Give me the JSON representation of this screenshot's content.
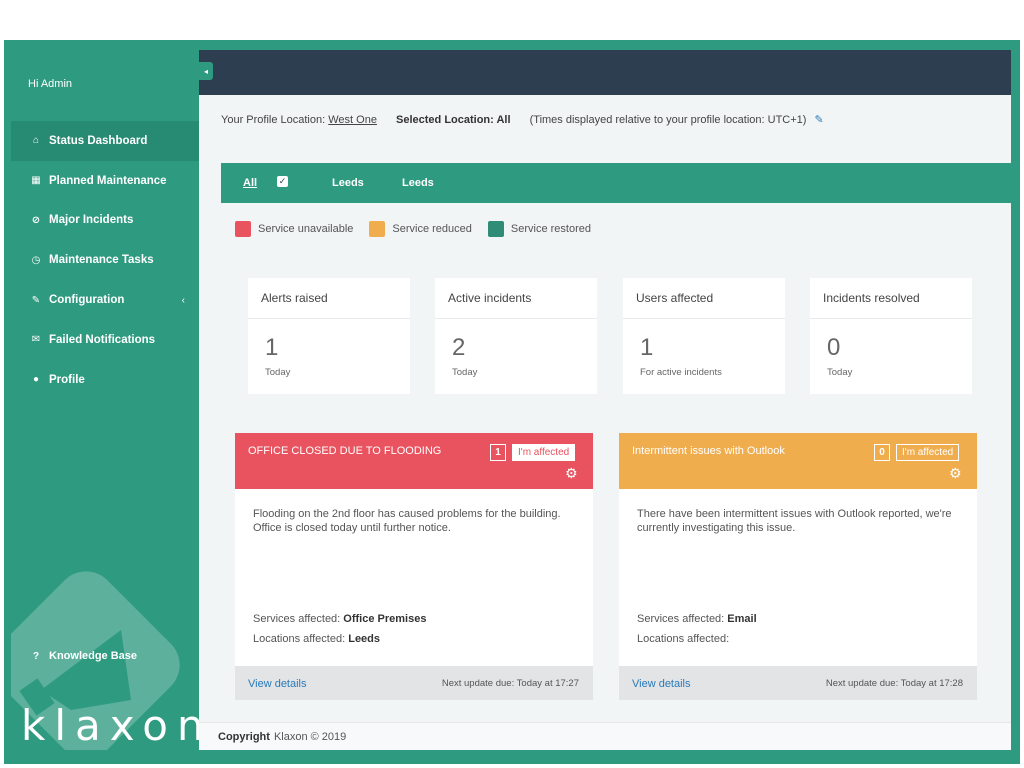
{
  "sidebar": {
    "greeting": "Hi Admin",
    "items": [
      {
        "label": "Status Dashboard",
        "icon": "dashboard-icon",
        "glyph": "⌂"
      },
      {
        "label": "Planned Maintenance",
        "icon": "calendar-icon",
        "glyph": "▦"
      },
      {
        "label": "Major Incidents",
        "icon": "ban-icon",
        "glyph": "⊘"
      },
      {
        "label": "Maintenance Tasks",
        "icon": "clock-icon",
        "glyph": "◷"
      },
      {
        "label": "Configuration",
        "icon": "wrench-icon",
        "glyph": "✎"
      },
      {
        "label": "Failed Notifications",
        "icon": "envelope-icon",
        "glyph": "✉"
      },
      {
        "label": "Profile",
        "icon": "user-icon",
        "glyph": "●"
      }
    ],
    "knowledge_base": "Knowledge Base",
    "logo": "klaxon"
  },
  "header": {
    "profile_location_label": "Your Profile Location:",
    "profile_location": "West One",
    "selected_location": "Selected Location: All",
    "timezone_note": "(Times displayed relative to your profile location: UTC+1)"
  },
  "filters": {
    "all": "All",
    "locations": [
      "Leeds",
      "Leeds"
    ]
  },
  "legend": [
    {
      "label": "Service unavailable",
      "color": "#e8535f"
    },
    {
      "label": "Service reduced",
      "color": "#f0ad4e"
    },
    {
      "label": "Service restored",
      "color": "#2e8c77"
    }
  ],
  "stats": [
    {
      "title": "Alerts raised",
      "value": "1",
      "sub": "Today"
    },
    {
      "title": "Active incidents",
      "value": "2",
      "sub": "Today"
    },
    {
      "title": "Users affected",
      "value": "1",
      "sub": "For active incidents"
    },
    {
      "title": "Incidents resolved",
      "value": "0",
      "sub": "Today"
    }
  ],
  "incidents": [
    {
      "title": "OFFICE CLOSED DUE TO FLOODING",
      "count": "1",
      "affected_label": "I'm affected",
      "description": "Flooding on the 2nd floor has caused problems for the building. Office is closed today until further notice.",
      "services_label": "Services affected:",
      "services": "Office Premises",
      "locations_label": "Locations affected:",
      "locations": "Leeds",
      "view_details": "View details",
      "next_update": "Next update due: Today at 17:27",
      "color": "#e8535f"
    },
    {
      "title": "Intermittent issues with Outlook",
      "count": "0",
      "affected_label": "I'm affected",
      "description": "There have been intermittent issues with Outlook reported, we're currently investigating this issue.",
      "services_label": "Services affected:",
      "services": "Email",
      "locations_label": "Locations affected:",
      "locations": "",
      "view_details": "View details",
      "next_update": "Next update due: Today at 17:28",
      "color": "#f0ad4e"
    }
  ],
  "footer": {
    "copyright_label": "Copyright",
    "copyright_text": "Klaxon © 2019"
  }
}
